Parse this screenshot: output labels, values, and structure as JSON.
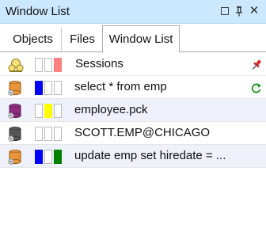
{
  "window": {
    "title": "Window List",
    "controls": {
      "maximize": "maximize-icon",
      "pin": "Ѩ",
      "close": "✕"
    }
  },
  "tabs": [
    {
      "label": "Objects",
      "active": false
    },
    {
      "label": "Files",
      "active": false
    },
    {
      "label": "Window List",
      "active": true
    }
  ],
  "rows": [
    {
      "label": "Sessions",
      "icon": "sessions-icon",
      "swatches": [
        "#ffffff",
        "#ffffff",
        "#ff8080"
      ],
      "right_icon": "pin-icon",
      "highlight": false
    },
    {
      "label": "select * from emp",
      "icon": "sql-window-icon",
      "swatches": [
        "#0000ff",
        "#ffffff",
        "#ffffff"
      ],
      "right_icon": "refresh-icon",
      "highlight": false
    },
    {
      "label": "employee.pck",
      "icon": "program-window-icon",
      "swatches": [
        "#ffffff",
        "#ffff00",
        "#ffffff"
      ],
      "right_icon": "",
      "highlight": true
    },
    {
      "label": "SCOTT.EMP@CHICAGO",
      "icon": "table-window-icon",
      "swatches": [
        "#ffffff",
        "#ffffff",
        "#ffffff"
      ],
      "right_icon": "",
      "highlight": false
    },
    {
      "label": "update emp set hiredate = ...",
      "icon": "sql-window-icon",
      "swatches": [
        "#0000ff",
        "#ffffff",
        "#008000"
      ],
      "right_icon": "",
      "highlight": true
    }
  ]
}
